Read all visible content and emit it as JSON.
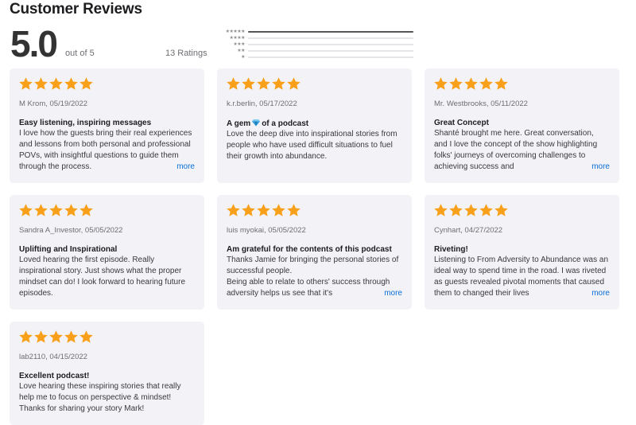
{
  "header": {
    "title": "Customer Reviews"
  },
  "summary": {
    "rating": "5.0",
    "out_of": "out of 5",
    "ratings_count": "13 Ratings",
    "distribution": [
      {
        "stars": "★★★★★",
        "fraction": 1.0
      },
      {
        "stars": "★★★★",
        "fraction": 0.0
      },
      {
        "stars": "★★★",
        "fraction": 0.0
      },
      {
        "stars": "★★",
        "fraction": 0.0
      },
      {
        "stars": "★",
        "fraction": 0.0
      }
    ]
  },
  "colors": {
    "star": "#f9a01b",
    "link": "#0a6fd6",
    "card_bg": "#f2f2f7"
  },
  "reviews": [
    {
      "rating": 5,
      "meta": "M Krom, 05/19/2022",
      "title": "Easy listening, inspiring messages",
      "body": "I love how the guests bring their real experiences and lessons from both personal and professional POVs, with insightful questions to guide them through the process.",
      "more": "more"
    },
    {
      "rating": 5,
      "meta": "k.r.berlin, 05/17/2022",
      "title_before": "A gem",
      "title_icon": "gem-icon",
      "title_after": "of a podcast",
      "body": "Love the deep dive into inspirational stories from people who have used difficult situations to fuel their growth into abundance."
    },
    {
      "rating": 5,
      "meta": "Mr. Westbrooks, 05/11/2022",
      "title": "Great Concept",
      "body": "Shanté brought me here. Great conversation, and I love the concept of the show highlighting folks' journeys of overcoming challenges to achieving success and",
      "more": "more"
    },
    {
      "rating": 5,
      "meta": "Sandra A_Investor, 05/05/2022",
      "title": "Uplifting and Inspirational",
      "body": "Loved hearing the first episode. Really inspirational story. Just shows what the proper mindset can do! I look forward to hearing future episodes."
    },
    {
      "rating": 5,
      "meta": "luis myokai, 05/05/2022",
      "title": "Am grateful for the contents of this podcast",
      "body": "Thanks Jamie for bringing the personal stories of successful people.\nBeing able to relate to others' success through adversity helps us see that it's",
      "more": "more"
    },
    {
      "rating": 5,
      "meta": "Cynhart, 04/27/2022",
      "title": "Riveting!",
      "body": "Listening to From Adversity to Abundance was an ideal way to spend time in the road. I was riveted as guests revealed pivotal moments that caused them to changed their lives",
      "more": "more"
    },
    {
      "rating": 5,
      "meta": "lab2110, 04/15/2022",
      "title": "Excellent podcast!",
      "body": "Love hearing these inspiring stories that really help me to focus on perspective & mindset! Thanks for sharing your story Mark!"
    }
  ]
}
